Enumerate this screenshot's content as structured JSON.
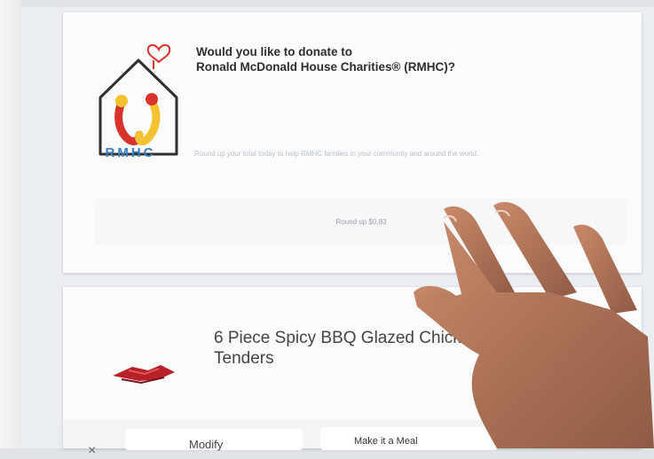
{
  "donation": {
    "org_short": "RMHC",
    "title_line1": "Would you like to donate to",
    "title_line2": "Ronald McDonald House Charities® (RMHC)?",
    "description": "Round up your total today to help RMHC families in your community and around the world.",
    "round_up_label": "Round up $0.83"
  },
  "item": {
    "name_line1": "6 Piece Spicy BBQ Glazed Chicken",
    "name_line2": "Tenders",
    "close_label": "×",
    "modify_label": "Modify",
    "meal_label": "Make it a Meal"
  },
  "colors": {
    "rmhc_blue": "#3a7fc1",
    "rmhc_red": "#d8342c",
    "rmhc_yellow": "#f2c230"
  },
  "icons": {
    "logo": "rmhc-house-heart-logo",
    "food": "chicken-tenders-image"
  }
}
